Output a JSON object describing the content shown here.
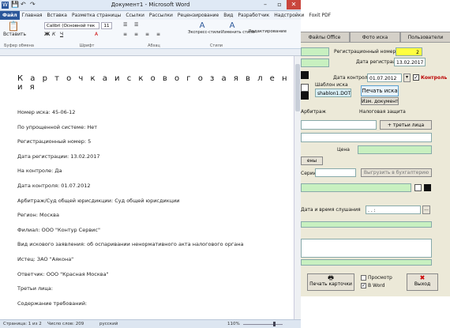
{
  "word": {
    "title": "Документ1 - Microsoft Word",
    "menu": [
      "Файл",
      "Главная",
      "Вставка",
      "Разметка страницы",
      "Ссылки",
      "Рассылки",
      "Рецензирование",
      "Вид",
      "Разработчик",
      "Надстройки",
      "Foxit PDF"
    ],
    "ribbon": {
      "paste": "Вставить",
      "font_name": "Calibri (Основной тек",
      "font_size": "11",
      "group_clipboard": "Буфер обмена",
      "group_font": "Шрифт",
      "group_paragraph": "Абзац",
      "group_styles": "Стили",
      "group_editing": "Редактирование",
      "express_styles": "Экспресс-стили",
      "change_styles": "Изменить стили",
      "editing": "Редактирование"
    },
    "document": {
      "heading": "К а р т о ч к а и с к о в о г о з а я в л е н и я",
      "lines": [
        "Номер иска: 45-06-12",
        "По упрощенной системе: Нет",
        "Регистрационный номер: 5",
        "Дата регистрации: 13.02.2017",
        "На контроле: Да",
        "Дата контроля: 01.07.2012",
        "Арбитраж/Суд общей юрисдикции: Суд общей юрисдикции",
        "Регион: Москва",
        "Филиал: ООО \"Контур Сервис\"",
        "Вид искового заявления: об оспаривании ненормативного акта налогового органа",
        "Истец: ЗАО \"Аякона\"",
        "Ответчик: ООО \"Красная Москва\"",
        "Третьи лица:",
        "Содержание требований:"
      ]
    },
    "status": {
      "page": "Страница: 1 из 2",
      "words": "Число слов: 209",
      "lang": "русский",
      "zoom": "110%"
    }
  },
  "app": {
    "tabs": [
      "Файлы Office",
      "Фото иска",
      "Пользователи"
    ],
    "reg_number_label": "Регистрационный номер",
    "reg_number_value": "2",
    "reg_date_label": "Дата регистрации",
    "reg_date_value": "13.02.2017",
    "control_date_label": "Дата контроля",
    "control_date_value": "01.07.2012",
    "control_checkbox_label": "Контроль",
    "template_label": "Шаблон иска",
    "template_value": "shablon1.DOT",
    "print_claim_button": "Печать иска",
    "change_docs_button": "Изм. документы",
    "tab2": [
      "Арбитраж",
      "Налоговая защита"
    ],
    "third_parties_button": "+ третьи лица",
    "price_label": "Цена",
    "series_label": "Серии",
    "upload_accounting_button": "Выгрузить в бухгалтерию",
    "hearing_label": "Дата и время слушания",
    "hearing_value": ". . :",
    "print_card_button": "Печать карточки",
    "preview_label": "Просмотр",
    "in_word_label": "В Word",
    "exit_button": "Выход"
  }
}
